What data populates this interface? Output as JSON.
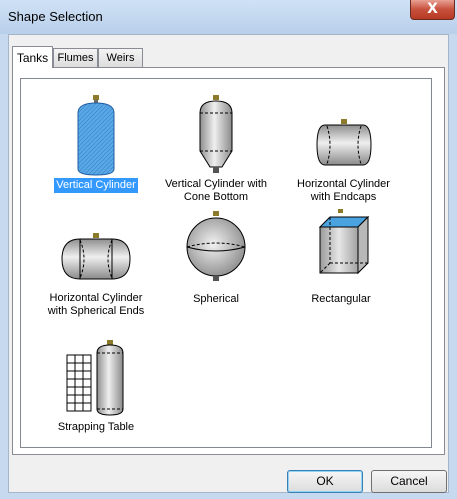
{
  "window": {
    "title": "Shape Selection",
    "close_glyph": "X"
  },
  "tabs": [
    {
      "label": "Tanks",
      "active": true
    },
    {
      "label": "Flumes",
      "active": false
    },
    {
      "label": "Weirs",
      "active": false
    }
  ],
  "shapes": [
    {
      "label": "Vertical Cylinder",
      "selected": true,
      "icon": "vertical-cylinder-icon"
    },
    {
      "label_lines": [
        "Vertical Cylinder with",
        "Cone Bottom"
      ],
      "selected": false,
      "icon": "vertical-cylinder-cone-bottom-icon"
    },
    {
      "label_lines": [
        "Horizontal Cylinder",
        "with Endcaps"
      ],
      "selected": false,
      "icon": "horizontal-cylinder-endcaps-icon"
    },
    {
      "label_lines": [
        "Horizontal Cylinder",
        "with Spherical Ends"
      ],
      "selected": false,
      "icon": "horizontal-cylinder-spherical-ends-icon"
    },
    {
      "label": "Spherical",
      "selected": false,
      "icon": "spherical-icon"
    },
    {
      "label": "Rectangular",
      "selected": false,
      "icon": "rectangular-icon"
    },
    {
      "label": "Strapping Table",
      "selected": false,
      "icon": "strapping-table-icon"
    }
  ],
  "buttons": {
    "ok": "OK",
    "cancel": "Cancel"
  },
  "colors": {
    "selection": "#3399ff",
    "tank_gray": "#c8c8c8",
    "water_blue": "#4aa3df",
    "fitting_gold": "#8a7a2a"
  }
}
